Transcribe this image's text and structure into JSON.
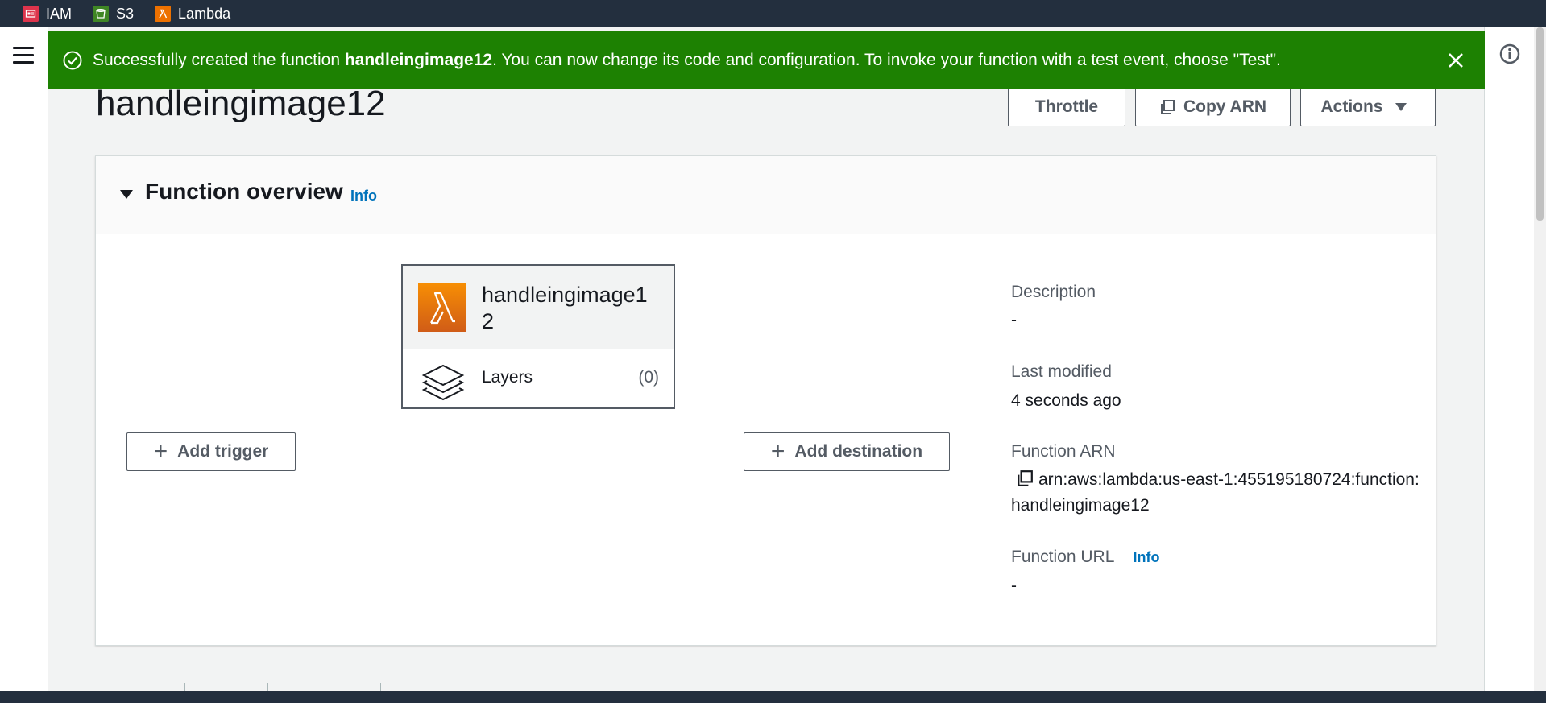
{
  "favorites": [
    {
      "label": "IAM",
      "icon": "iam-icon",
      "color": "#dd344c"
    },
    {
      "label": "S3",
      "icon": "s3-icon",
      "color": "#3f8624"
    },
    {
      "label": "Lambda",
      "icon": "lambda-icon",
      "color": "#ed7100"
    }
  ],
  "flash": {
    "prefix": "Successfully created the function ",
    "function_name": "handleingimage12",
    "suffix": ". You can now change its code and configuration. To invoke your function with a test event, choose \"Test\".",
    "color": "#1d8102"
  },
  "header": {
    "title": "handleingimage12",
    "throttle_label": "Throttle",
    "copy_arn_label": "Copy ARN",
    "actions_label": "Actions"
  },
  "overview": {
    "title": "Function overview",
    "info_label": "Info",
    "function_card": {
      "name": "handleingimage12",
      "layers_label": "Layers",
      "layers_count": "(0)"
    },
    "add_trigger_label": "Add trigger",
    "add_destination_label": "Add destination",
    "details": {
      "description_label": "Description",
      "description_value": "-",
      "last_modified_label": "Last modified",
      "last_modified_value": "4 seconds ago",
      "function_arn_label": "Function ARN",
      "function_arn_value": "arn:aws:lambda:us-east-1:455195180724:function:handleingimage12",
      "function_url_label": "Function URL",
      "function_url_info": "Info",
      "function_url_value": "-"
    }
  },
  "colors": {
    "nav_dark": "#232f3e",
    "link_blue": "#0073bb",
    "lambda_orange": "#ed7100"
  }
}
